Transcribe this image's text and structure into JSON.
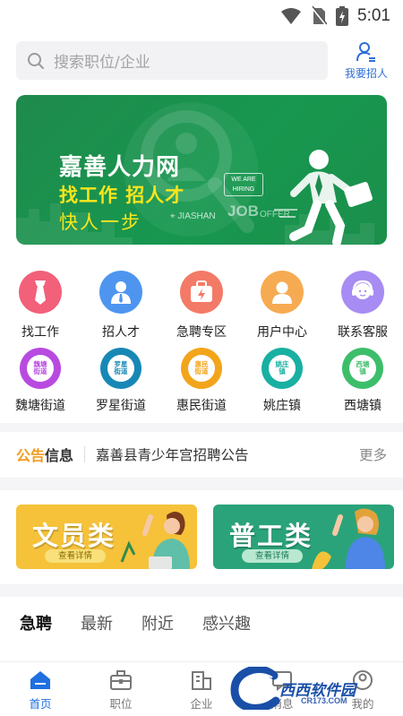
{
  "status_bar": {
    "time": "5:01"
  },
  "search": {
    "placeholder": "搜索职位/企业"
  },
  "recruit_button": {
    "label": "我要招人"
  },
  "banner": {
    "title": "嘉善人力网",
    "slogan": "找工作  招人才",
    "tagline": "快人一步",
    "location": "JIASHAN",
    "badge": "WE ARE HIRING",
    "job_text": "JOB",
    "offer_text": "OFFER"
  },
  "quick_menu": [
    {
      "label": "找工作",
      "icon": "tie-icon",
      "color": "#f2607a"
    },
    {
      "label": "招人才",
      "icon": "person-tie-icon",
      "color": "#4e95f0"
    },
    {
      "label": "急聘专区",
      "icon": "urgent-bag-icon",
      "color": "#f37a66"
    },
    {
      "label": "用户中心",
      "icon": "user-icon",
      "color": "#f6ab52"
    },
    {
      "label": "联系客服",
      "icon": "service-icon",
      "color": "#a68cf3"
    }
  ],
  "districts": [
    {
      "label": "魏塘街道",
      "badge": "魏塘\n街道",
      "color": "#b84ae0"
    },
    {
      "label": "罗星街道",
      "badge": "罗星\n街道",
      "color": "#1788b5"
    },
    {
      "label": "惠民街道",
      "badge": "惠民\n街道",
      "color": "#f2a51a"
    },
    {
      "label": "姚庄镇",
      "badge": "姚庄\n镇",
      "color": "#18b0a2"
    },
    {
      "label": "西塘镇",
      "badge": "西塘\n镇",
      "color": "#3dbe6a"
    }
  ],
  "notice": {
    "tag_part1": "公告",
    "tag_part2": "信息",
    "text": "嘉善县青少年宫招聘公告",
    "more": "更多"
  },
  "category_cards": [
    {
      "title": "文员类",
      "button": "查看详情",
      "color": "#f5c23a"
    },
    {
      "title": "普工类",
      "button": "查看详情",
      "color": "#2aa37a"
    }
  ],
  "tabs": [
    "急聘",
    "最新",
    "附近",
    "感兴趣"
  ],
  "bottom_nav": [
    {
      "label": "首页",
      "icon": "home-icon",
      "active": true
    },
    {
      "label": "职位",
      "icon": "briefcase-icon",
      "active": false
    },
    {
      "label": "企业",
      "icon": "building-icon",
      "active": false
    },
    {
      "label": "消息",
      "icon": "message-icon",
      "active": false
    },
    {
      "label": "我的",
      "icon": "profile-icon",
      "active": false
    }
  ],
  "watermark": {
    "text": "西西软件园",
    "sub": "CR173.COM"
  },
  "colors": {
    "accent": "#1f6fe0",
    "banner_green": "#17974f",
    "notice_orange": "#f29a1c"
  }
}
